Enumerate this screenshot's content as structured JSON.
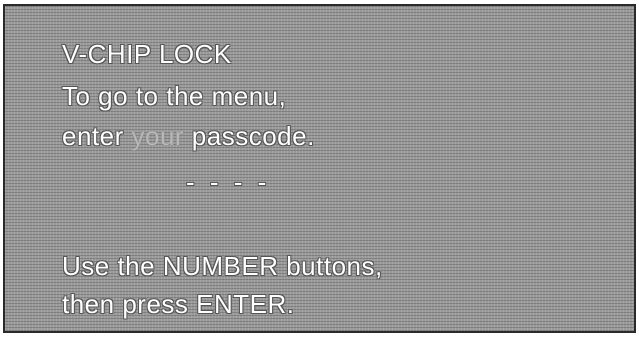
{
  "osd": {
    "title": "V-CHIP LOCK",
    "instruction_line1": "To go to the menu,",
    "instruction_line2_prefix": "enter ",
    "instruction_line2_highlight": "your",
    "instruction_line2_suffix": " passcode.",
    "passcode_entry": "- - - -",
    "help_line1": "Use the NUMBER buttons,",
    "help_line2": "then press ENTER."
  }
}
